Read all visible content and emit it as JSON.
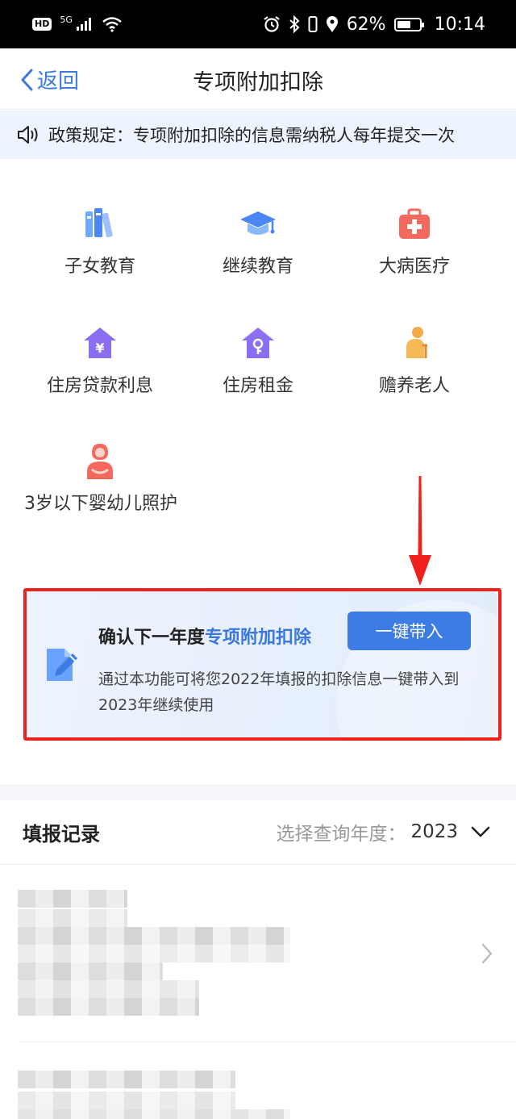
{
  "status_bar": {
    "hd": "HD",
    "network": "5G",
    "battery": "62%",
    "battery_level": 0.62,
    "time": "10:14"
  },
  "nav": {
    "back_label": "返回",
    "title": "专项附加扣除"
  },
  "notice": {
    "text": "政策规定：专项附加扣除的信息需纳税人每年提交一次"
  },
  "categories": [
    {
      "label": "子女教育",
      "icon": "books-icon"
    },
    {
      "label": "继续教育",
      "icon": "graduation-cap-icon"
    },
    {
      "label": "大病医疗",
      "icon": "medical-kit-icon"
    },
    {
      "label": "住房贷款利息",
      "icon": "house-yuan-icon"
    },
    {
      "label": "住房租金",
      "icon": "house-key-icon"
    },
    {
      "label": "赡养老人",
      "icon": "elderly-person-icon"
    },
    {
      "label": "3岁以下婴幼儿照护",
      "icon": "mother-baby-icon"
    }
  ],
  "card": {
    "title_prefix": "确认下一年度",
    "title_highlight": "专项附加扣除",
    "button_label": "一键带入",
    "description": "通过本功能可将您2022年填报的扣除信息一键带入到2023年继续使用",
    "icon": "edit-document-icon"
  },
  "records": {
    "title": "填报记录",
    "year_label": "选择查询年度：",
    "year_value": "2023"
  },
  "colors": {
    "accent": "#3d7ce5",
    "highlight_frame": "#f0211c",
    "notice_bg": "#eef4fd"
  }
}
